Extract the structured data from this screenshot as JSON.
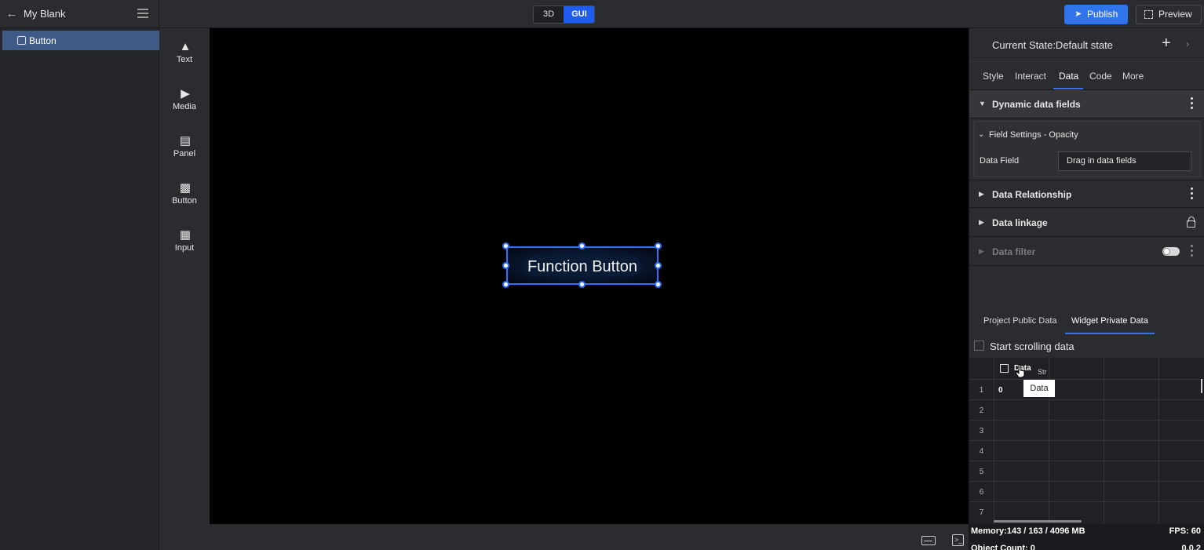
{
  "header": {
    "project_title": "My Blank",
    "mode_3d": "3D",
    "mode_gui": "GUI",
    "publish_label": "Publish",
    "preview_label": "Preview"
  },
  "layers": {
    "items": [
      {
        "label": "Button",
        "icon": "button-layer-icon"
      }
    ]
  },
  "palette": {
    "items": [
      {
        "label": "Text",
        "icon": "text-icon"
      },
      {
        "label": "Media",
        "icon": "media-icon"
      },
      {
        "label": "Panel",
        "icon": "panel-icon"
      },
      {
        "label": "Button",
        "icon": "button-icon"
      },
      {
        "label": "Input",
        "icon": "input-icon"
      }
    ]
  },
  "canvas": {
    "widget_label": "Function Button",
    "selection_color": "#2f72ff"
  },
  "properties": {
    "state_title": "Current State:Default state",
    "tabs": [
      {
        "label": "Style"
      },
      {
        "label": "Interact"
      },
      {
        "label": "Data",
        "active": true
      },
      {
        "label": "Code"
      },
      {
        "label": "More"
      }
    ],
    "sections": {
      "dynamic": "Dynamic data fields",
      "field_settings": "Field Settings - Opacity",
      "data_field_label": "Data Field",
      "data_field_value": "Drag in data fields",
      "relationship": "Data Relationship",
      "linkage": "Data linkage",
      "filter": "Data filter"
    },
    "data_tabs": {
      "public": "Project Public Data",
      "private": "Widget Private Data"
    },
    "scroll_label": "Start scrolling data",
    "grid": {
      "header_data": "Data",
      "header_str": "Str",
      "row_numbers": [
        "1",
        "2",
        "3",
        "4",
        "5",
        "6",
        "7"
      ],
      "cell_value": "0",
      "tooltip": "Data"
    }
  },
  "statusbar": {
    "memory": "Memory:143 / 163 / 4096 MB",
    "fps": "FPS: 60",
    "object_count": "Object Count: 0",
    "version": "0.0.2"
  },
  "colors": {
    "accent": "#2f74ea",
    "gui_active": "#1f5cf0"
  }
}
